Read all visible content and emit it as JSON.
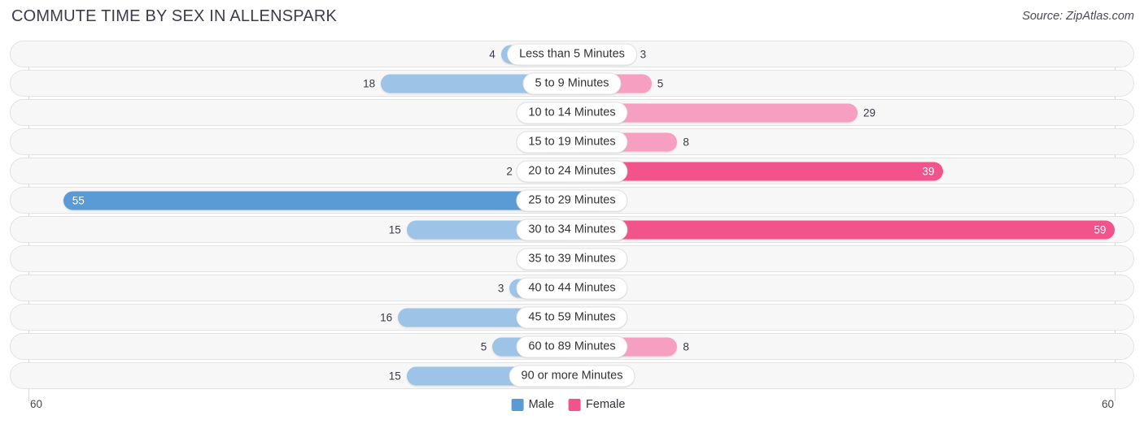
{
  "header": {
    "title": "COMMUTE TIME BY SEX IN ALLENSPARK",
    "source": "Source: ZipAtlas.com"
  },
  "axis": {
    "left_label": "60",
    "right_label": "60"
  },
  "legend": {
    "items": [
      {
        "label": "Male",
        "color": "#5b9bd5"
      },
      {
        "label": "Female",
        "color": "#f2538a"
      }
    ]
  },
  "colors": {
    "male_light": "#9dc3e6",
    "male_dark": "#5b9bd5",
    "female_light": "#f79fc0",
    "female_dark": "#f2538a",
    "track": "#f7f7f7",
    "track_border": "#e3e3e3"
  },
  "chart_data": {
    "type": "bar",
    "orientation": "horizontal-diverging",
    "title": "COMMUTE TIME BY SEX IN ALLENSPARK",
    "xlabel": "",
    "ylabel": "",
    "xlim": [
      60,
      60
    ],
    "axis_max": 60,
    "grid": false,
    "legend_position": "bottom-center",
    "categories": [
      "Less than 5 Minutes",
      "5 to 9 Minutes",
      "10 to 14 Minutes",
      "15 to 19 Minutes",
      "20 to 24 Minutes",
      "25 to 29 Minutes",
      "30 to 34 Minutes",
      "35 to 39 Minutes",
      "40 to 44 Minutes",
      "45 to 59 Minutes",
      "60 to 89 Minutes",
      "90 or more Minutes"
    ],
    "series": [
      {
        "name": "Male",
        "values": [
          4,
          18,
          0,
          0,
          2,
          55,
          15,
          0,
          3,
          16,
          5,
          15
        ]
      },
      {
        "name": "Female",
        "values": [
          3,
          5,
          29,
          8,
          39,
          0,
          59,
          0,
          0,
          0,
          8,
          0
        ]
      }
    ]
  },
  "rows": [
    {
      "label": "Less than 5 Minutes",
      "male": "4",
      "female": "3"
    },
    {
      "label": "5 to 9 Minutes",
      "male": "18",
      "female": "5"
    },
    {
      "label": "10 to 14 Minutes",
      "male": "0",
      "female": "29"
    },
    {
      "label": "15 to 19 Minutes",
      "male": "0",
      "female": "8"
    },
    {
      "label": "20 to 24 Minutes",
      "male": "2",
      "female": "39"
    },
    {
      "label": "25 to 29 Minutes",
      "male": "55",
      "female": "0"
    },
    {
      "label": "30 to 34 Minutes",
      "male": "15",
      "female": "59"
    },
    {
      "label": "35 to 39 Minutes",
      "male": "0",
      "female": "0"
    },
    {
      "label": "40 to 44 Minutes",
      "male": "3",
      "female": "0"
    },
    {
      "label": "45 to 59 Minutes",
      "male": "16",
      "female": "0"
    },
    {
      "label": "60 to 89 Minutes",
      "male": "5",
      "female": "8"
    },
    {
      "label": "90 or more Minutes",
      "male": "15",
      "female": "0"
    }
  ]
}
